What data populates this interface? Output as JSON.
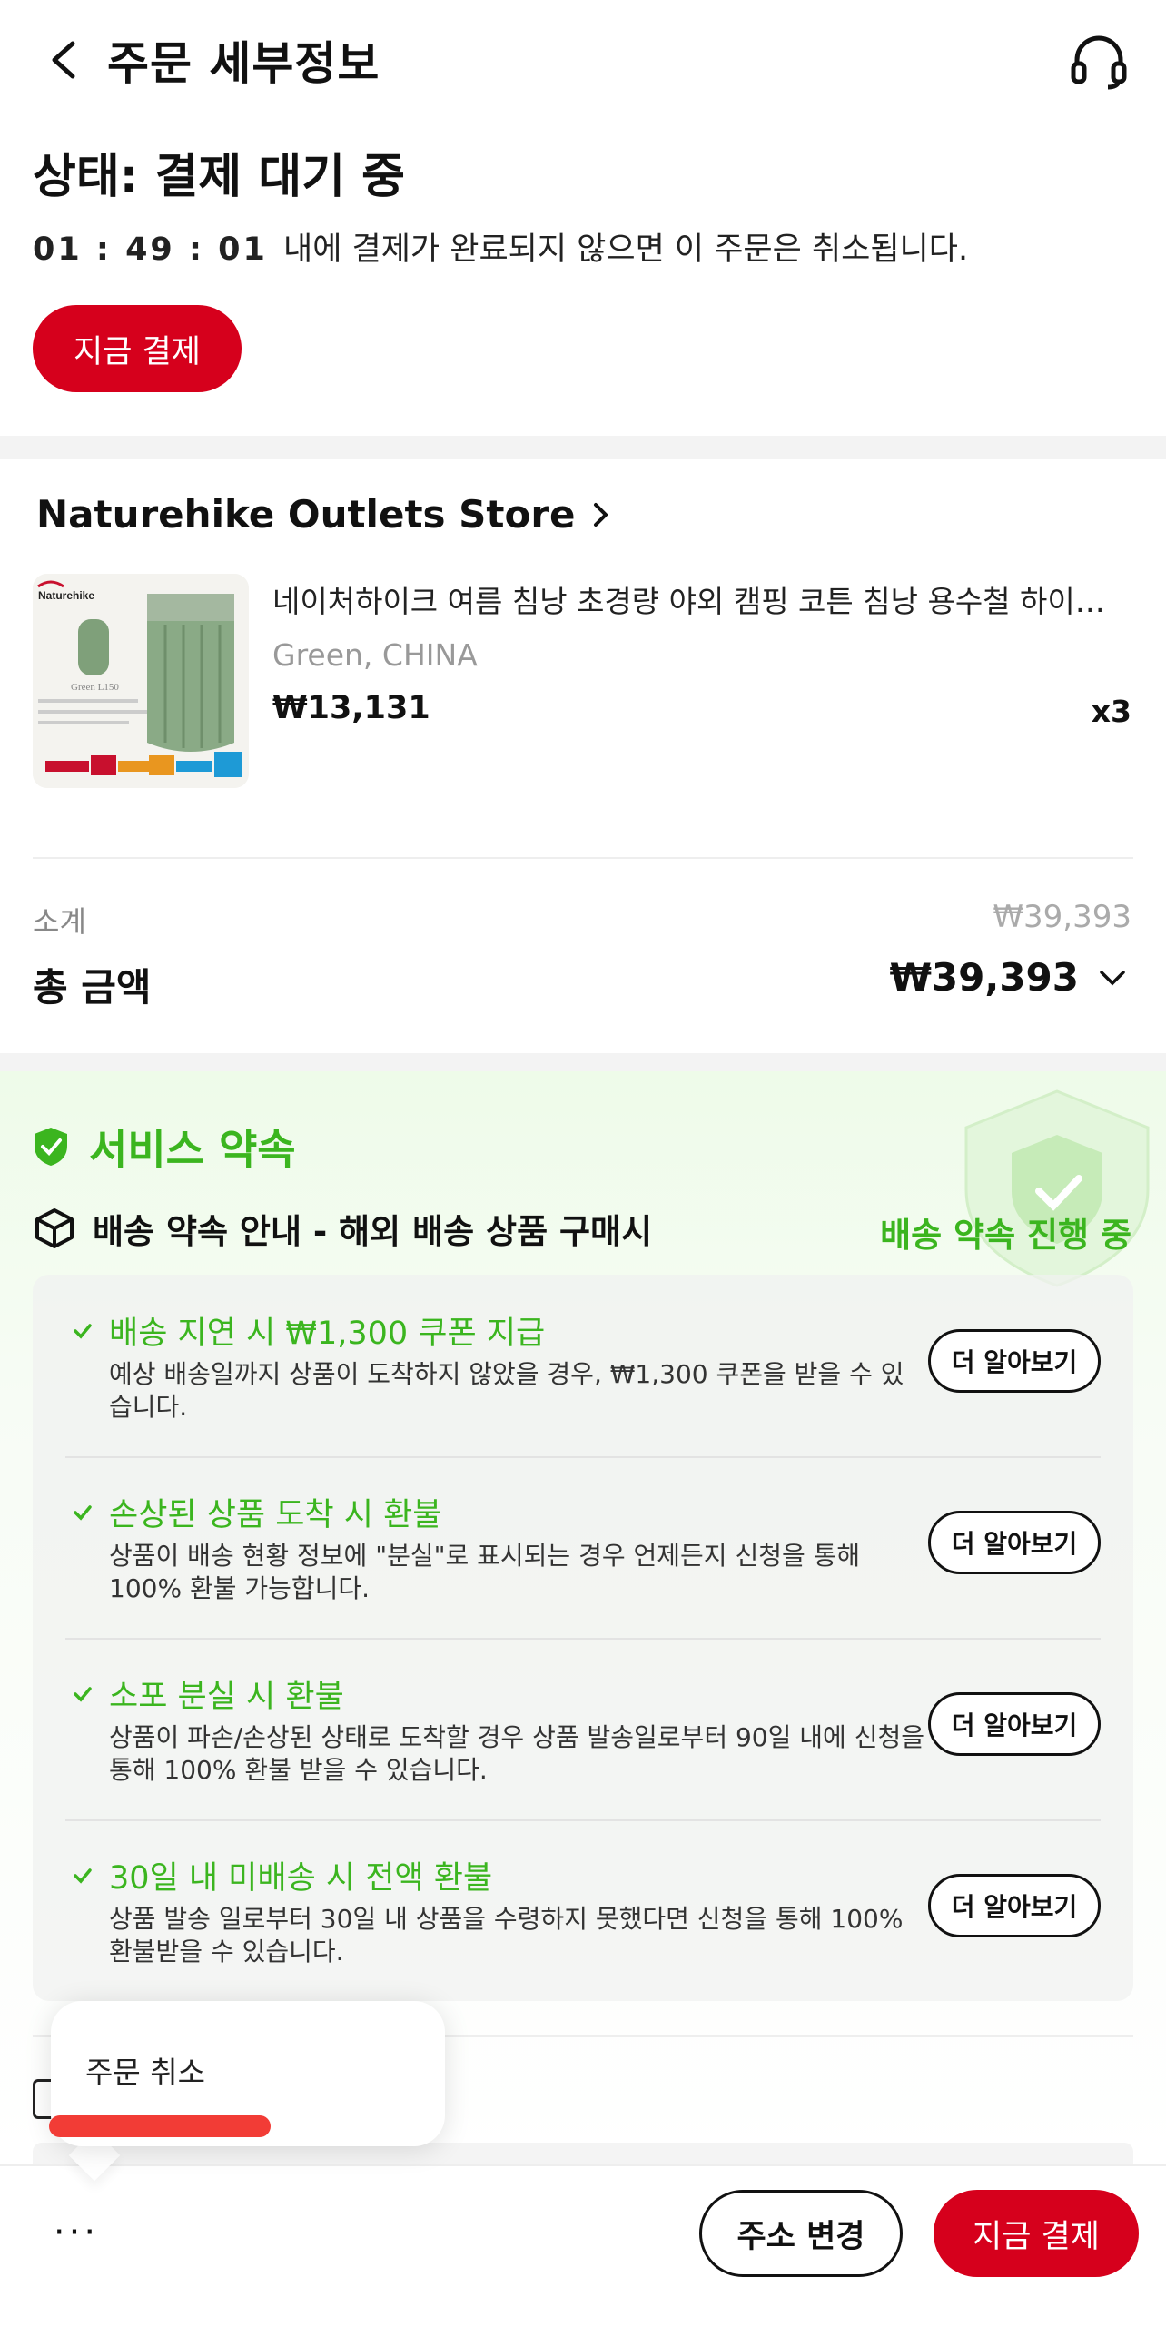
{
  "header": {
    "title": "주문 세부정보"
  },
  "status": {
    "title": "상태: 결제 대기 중",
    "timer": "01 : 49 : 01",
    "timer_message": "내에 결제가 완료되지 않으면 이 주문은 취소됩니다.",
    "pay_now_label": "지금 결제"
  },
  "store": {
    "name": "Naturehike Outlets Store",
    "product": {
      "name": "네이처하이크 여름 침낭 초경량 야외 캠핑 코튼 침낭 용수철 하이…",
      "variant": "Green, CHINA",
      "price": "₩13,131",
      "quantity": "x3",
      "image_brand": "Naturehike",
      "image_model": "Green L150"
    },
    "subtotal_label": "소계",
    "subtotal_value": "₩39,393",
    "total_label": "총 금액",
    "total_value": "₩39,393"
  },
  "service": {
    "title": "서비스 약속",
    "shipping_title": "배송 약속 안내 - 해외 배송 상품 구매시",
    "shipping_status": "배송 약속 진행 중",
    "items": [
      {
        "title": "배송 지연 시 ₩1,300 쿠폰 지급",
        "desc": "예상 배송일까지 상품이 도착하지 않았을 경우, ₩1,300 쿠폰을 받을 수 있습니다.",
        "button": "더 알아보기"
      },
      {
        "title": "손상된 상품 도착 시 환불",
        "desc": "상품이 배송 현황 정보에 \"분실\"로 표시되는 경우 언제든지 신청을 통해 100% 환불 가능합니다.",
        "button": "더 알아보기"
      },
      {
        "title": "소포 분실 시 환불",
        "desc": "상품이 파손/손상된 상태로 도착할 경우 상품 발송일로부터 90일 내에 신청을 통해 100% 환불 받을 수 있습니다.",
        "button": "더 알아보기"
      },
      {
        "title": "30일 내 미배송 시 전액 환불",
        "desc": "상품 발송 일로부터 30일 내 상품을 수령하지 못했다면 신청을 통해 100% 환불받을 수 있습니다.",
        "button": "더 알아보기"
      }
    ]
  },
  "popover": {
    "cancel_label": "주문 취소"
  },
  "bottom_bar": {
    "more_label": "···",
    "change_address_label": "주소 변경",
    "pay_now_label": "지금 결제"
  },
  "colors": {
    "brand_red": "#d6001c",
    "success_green": "#3bb51f"
  },
  "icons": [
    "back-arrow-icon",
    "headset-icon",
    "chevron-right-icon",
    "chevron-down-icon",
    "shield-check-icon",
    "package-box-icon",
    "check-icon"
  ]
}
